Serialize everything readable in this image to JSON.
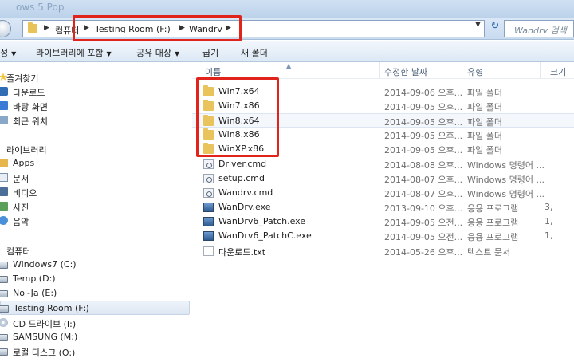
{
  "window": {
    "title_fragment": "ows 5 Pop"
  },
  "address_bar": {
    "crumbs": [
      "컴퓨터",
      "Testing Room (F:)",
      "Wandrv"
    ],
    "search_placeholder": "Wandrv 검색"
  },
  "toolbar": {
    "organize_label": "성",
    "include_in_library_label": "라이브러리에 포함",
    "share_label": "공유 대상",
    "burn_label": "굽기",
    "new_folder_label": "새 폴더"
  },
  "sidebar": {
    "favorites_header": "즐겨찾기",
    "favorites": [
      {
        "label": "다운로드",
        "icon": "download-icon"
      },
      {
        "label": "바탕 화면",
        "icon": "desktop-icon"
      },
      {
        "label": "최근 위치",
        "icon": "recent-places-icon"
      }
    ],
    "libraries_header": "라이브러리",
    "libraries": [
      {
        "label": "Apps",
        "icon": "library-icon"
      },
      {
        "label": "문서",
        "icon": "documents-icon"
      },
      {
        "label": "비디오",
        "icon": "video-icon"
      },
      {
        "label": "사진",
        "icon": "pictures-icon"
      },
      {
        "label": "음악",
        "icon": "music-icon"
      }
    ],
    "computer_header": "컴퓨터",
    "drives": [
      {
        "label": "Windows7 (C:)",
        "icon": "drive-icon"
      },
      {
        "label": "Temp (D:)",
        "icon": "drive-icon"
      },
      {
        "label": "Nol-Ja (E:)",
        "icon": "drive-icon"
      },
      {
        "label": "Testing Room (F:)",
        "icon": "drive-icon",
        "selected": true
      },
      {
        "label": "CD 드라이브 (I:)",
        "icon": "cd-drive-icon"
      },
      {
        "label": "SAMSUNG (M:)",
        "icon": "drive-icon"
      },
      {
        "label": "로컬 디스크 (O:)",
        "icon": "drive-icon"
      }
    ]
  },
  "file_list": {
    "columns": {
      "name": "이름",
      "date": "수정한 날짜",
      "type": "유형",
      "size": "크기"
    },
    "rows": [
      {
        "name": "Win7.x64",
        "date": "2014-09-06 오후...",
        "type": "파일 폴더",
        "size": "",
        "icon": "folder-icon"
      },
      {
        "name": "Win7.x86",
        "date": "2014-09-05 오후...",
        "type": "파일 폴더",
        "size": "",
        "icon": "folder-icon"
      },
      {
        "name": "Win8.x64",
        "date": "2014-09-05 오후...",
        "type": "파일 폴더",
        "size": "",
        "icon": "folder-icon",
        "highlighted": true
      },
      {
        "name": "Win8.x86",
        "date": "2014-09-05 오후...",
        "type": "파일 폴더",
        "size": "",
        "icon": "folder-icon"
      },
      {
        "name": "WinXP.x86",
        "date": "2014-09-05 오후...",
        "type": "파일 폴더",
        "size": "",
        "icon": "folder-icon"
      },
      {
        "name": "Driver.cmd",
        "date": "2014-08-08 오후...",
        "type": "Windows 명령어 ...",
        "size": "",
        "icon": "cmd-file-icon"
      },
      {
        "name": "setup.cmd",
        "date": "2014-08-07 오후...",
        "type": "Windows 명령어 ...",
        "size": "",
        "icon": "cmd-file-icon"
      },
      {
        "name": "Wandrv.cmd",
        "date": "2014-08-07 오후...",
        "type": "Windows 명령어 ...",
        "size": "",
        "icon": "cmd-file-icon"
      },
      {
        "name": "WanDrv.exe",
        "date": "2013-09-10 오후...",
        "type": "응용 프로그램",
        "size": "3,",
        "icon": "exe-file-icon"
      },
      {
        "name": "WanDrv6_Patch.exe",
        "date": "2014-09-05 오전...",
        "type": "응용 프로그램",
        "size": "1,",
        "icon": "exe-file-icon"
      },
      {
        "name": "WanDrv6_PatchC.exe",
        "date": "2014-09-05 오전...",
        "type": "응용 프로그램",
        "size": "1,",
        "icon": "exe-file-icon"
      },
      {
        "name": "다운로드.txt",
        "date": "2014-05-26 오후...",
        "type": "텍스트 문서",
        "size": "",
        "icon": "text-file-icon"
      }
    ]
  },
  "colors": {
    "highlight_red": "#e0241c",
    "folder_yellow": "#e9c35c"
  }
}
